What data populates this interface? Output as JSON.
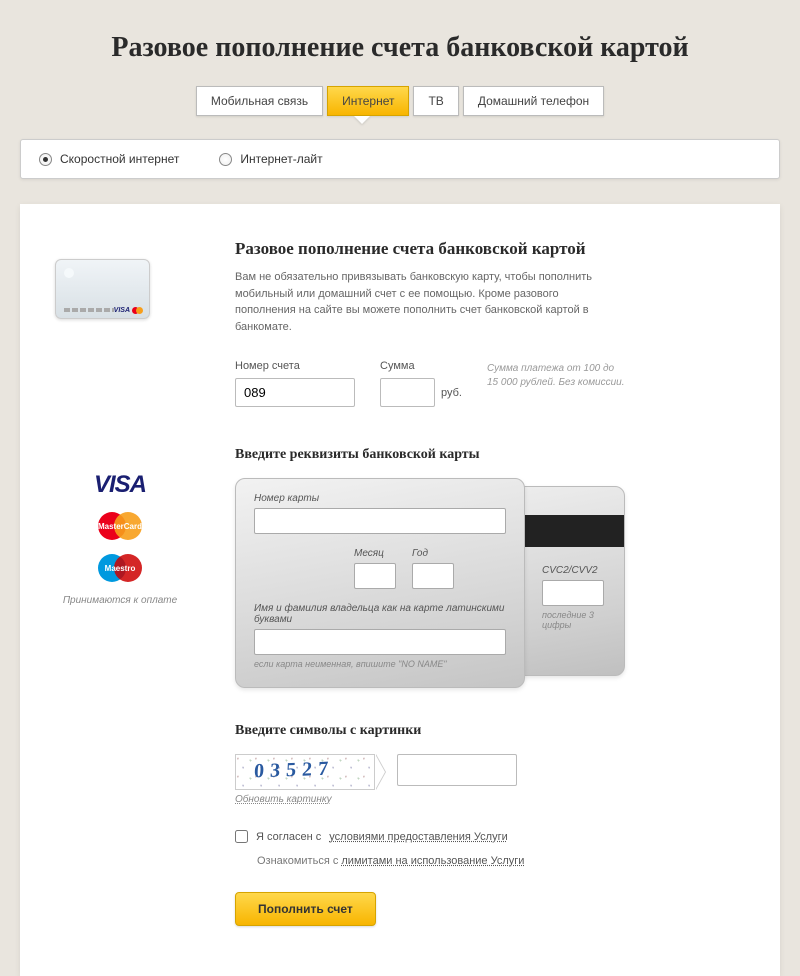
{
  "page_title": "Разовое пополнение счета банковской картой",
  "tabs": {
    "mobile": "Мобильная связь",
    "internet": "Интернет",
    "tv": "ТВ",
    "home_phone": "Домашний телефон"
  },
  "radio": {
    "fast": "Скоростной интернет",
    "lite": "Интернет-лайт"
  },
  "section": {
    "title": "Разовое пополнение счета банковской картой",
    "intro": "Вам не обязательно привязывать банковскую карту, чтобы пополнить мобильный или домашний счет с ее помощью. Кроме разового пополнения на сайте вы можете пополнить счет банковской картой в банкомате."
  },
  "fields": {
    "account_label": "Номер счета",
    "account_value": "089",
    "amount_label": "Сумма",
    "amount_value": "",
    "currency": "руб.",
    "amount_hint": "Сумма платежа от 100 до 15 000 рублей. Без комиссии."
  },
  "card": {
    "section_title": "Введите реквизиты банковской карты",
    "number_label": "Номер карты",
    "month_label": "Месяц",
    "year_label": "Год",
    "name_label": "Имя и фамилия владельца как на карте латинскими буквами",
    "name_hint": "если карта неименная, впишите \"NO NAME\"",
    "cvc_label": "CVC2/CVV2",
    "cvc_hint": "последние 3 цифры"
  },
  "logos": {
    "visa": "VISA",
    "mastercard": "MasterCard",
    "maestro": "Maestro",
    "accepted": "Принимаются к оплате"
  },
  "captcha": {
    "title": "Введите символы с картинки",
    "sample": "03527",
    "refresh": "Обновить картинку"
  },
  "agree": {
    "prefix": "Я согласен с ",
    "terms_link": "условиями предоставления Услуги",
    "limits_prefix": "Ознакомиться с ",
    "limits_link": "лимитами на использование Услуги"
  },
  "submit": "Пополнить счет"
}
